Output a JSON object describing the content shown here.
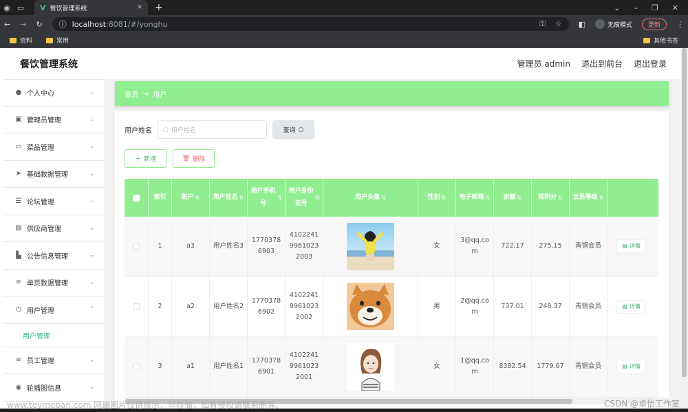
{
  "browser": {
    "tab_title": "餐饮管理系统",
    "url_host": "localhost",
    "url_path": ":8081/#/yonghu",
    "incognito_label": "无痕模式",
    "update_label": "更新",
    "bookmarks": [
      "资料",
      "常用"
    ],
    "other_bookmarks": "其他书签"
  },
  "header": {
    "title": "餐饮管理系统",
    "admin": "管理员 admin",
    "front": "退出到前台",
    "logout": "退出登录"
  },
  "sidebar": {
    "items": [
      {
        "label": "个人中心",
        "icon": "user-icon"
      },
      {
        "label": "管理员管理",
        "icon": "clipboard-icon"
      },
      {
        "label": "菜品管理",
        "icon": "chat-icon"
      },
      {
        "label": "基础数据管理",
        "icon": "send-icon"
      },
      {
        "label": "论坛管理",
        "icon": "sliders-icon"
      },
      {
        "label": "供应商管理",
        "icon": "printer-icon"
      },
      {
        "label": "公告信息管理",
        "icon": "chart-icon"
      },
      {
        "label": "单页数据管理",
        "icon": "list-icon"
      },
      {
        "label": "用户管理",
        "icon": "power-icon"
      },
      {
        "label": "员工管理",
        "icon": "list-icon"
      },
      {
        "label": "轮播图信息",
        "icon": "location-icon"
      }
    ],
    "active_sub": "用户管理"
  },
  "breadcrumb": {
    "home": "首页",
    "arrow": "→",
    "current": "用户"
  },
  "search": {
    "label": "用户姓名",
    "placeholder": "用户姓名",
    "query_label": "查询"
  },
  "actions": {
    "add_label": "新增",
    "delete_label": "删除"
  },
  "table": {
    "headers": [
      "",
      "索引",
      "账户",
      "用户姓名",
      "用户手机号",
      "用户身份证号",
      "用户头像",
      "性别",
      "电子邮箱",
      "余额",
      "现积分",
      "会员等级",
      ""
    ],
    "detail_label": "详情",
    "rows": [
      {
        "index": "1",
        "account": "a3",
        "name": "用户姓名3",
        "phone": "17703786903",
        "idcard": "410224199610232003",
        "avatar": "girl-photo",
        "gender": "女",
        "email": "3@qq.com",
        "balance": "722.17",
        "points": "275.15",
        "level": "青铜会员"
      },
      {
        "index": "2",
        "account": "a2",
        "name": "用户姓名2",
        "phone": "17703786902",
        "idcard": "410224199610232002",
        "avatar": "shiba-dog-photo",
        "gender": "男",
        "email": "2@qq.com",
        "balance": "737.01",
        "points": "248.37",
        "level": "青铜会员"
      },
      {
        "index": "3",
        "account": "a1",
        "name": "用户姓名1",
        "phone": "17703786901",
        "idcard": "410224199610232001",
        "avatar": "cartoon-girl",
        "gender": "女",
        "email": "1@qq.com",
        "balance": "8382.54",
        "points": "1779.67",
        "level": "青铜会员"
      }
    ]
  },
  "watermark": {
    "left": "www.toymoban.com 网络图片仅供展示，非存储，如有侵权请联系删除。",
    "right": "CSDN @卓怡工作室"
  },
  "colors": {
    "accent": "#90ee90",
    "active": "#3bbf8a",
    "danger": "#f56c6c"
  }
}
